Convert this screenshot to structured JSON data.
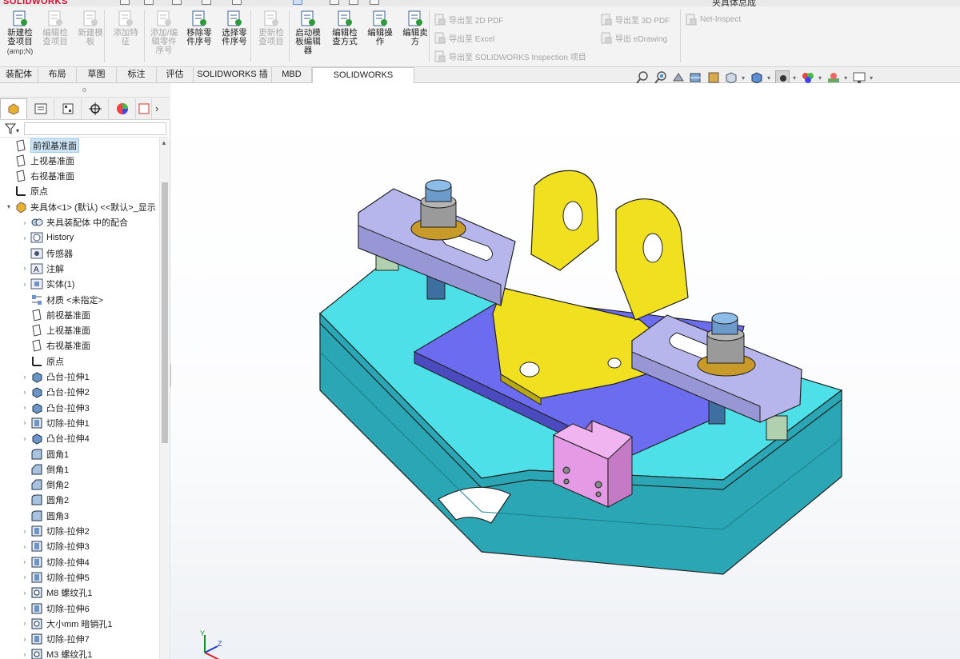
{
  "app": {
    "logo_text": "SOLIDWORKS",
    "document_title": "夹具体总成"
  },
  "ribbon": {
    "buttons": [
      {
        "label": "新建检\n查项目",
        "sub": "(amp;N)",
        "enabled": true,
        "icon": "new-inspection-icon"
      },
      {
        "label": "编辑检\n查项目",
        "sub": "",
        "enabled": false,
        "icon": "edit-inspection-icon"
      },
      {
        "label": "新建模\n板",
        "sub": "",
        "enabled": false,
        "icon": "new-template-icon"
      },
      {
        "label": "添加特\n征",
        "sub": "",
        "enabled": false,
        "icon": "add-feature-icon"
      },
      {
        "label": "添加/编\n辑零件\n序号",
        "sub": "",
        "enabled": false,
        "icon": "balloon-add-icon"
      },
      {
        "label": "移除零\n件序号",
        "sub": "",
        "enabled": true,
        "icon": "balloon-remove-icon"
      },
      {
        "label": "选择零\n件序号",
        "sub": "",
        "enabled": true,
        "icon": "balloon-select-icon"
      },
      {
        "label": "更新检\n查项目",
        "sub": "",
        "enabled": false,
        "icon": "update-inspection-icon"
      },
      {
        "label": "启动模\n板编辑\n器",
        "sub": "",
        "enabled": true,
        "icon": "template-editor-icon"
      },
      {
        "label": "编辑检\n查方式",
        "sub": "",
        "enabled": true,
        "icon": "edit-method-icon"
      },
      {
        "label": "编辑操\n作",
        "sub": "",
        "enabled": true,
        "icon": "edit-operation-icon"
      },
      {
        "label": "编辑卖\n方",
        "sub": "",
        "enabled": true,
        "icon": "edit-vendor-icon"
      }
    ],
    "export_items": [
      {
        "label": "导出至 2D PDF",
        "icon": "pdf2d-icon"
      },
      {
        "label": "导出至 Excel",
        "icon": "excel-icon"
      },
      {
        "label": "导出至 SOLIDWORKS Inspection 项目",
        "icon": "inspection-project-icon"
      },
      {
        "label": "导出至 3D PDF",
        "icon": "pdf3d-icon"
      },
      {
        "label": "导出 eDrawing",
        "icon": "edrawing-icon"
      },
      {
        "label": "Net-Inspect",
        "icon": "net-inspect-icon"
      }
    ]
  },
  "tabs": [
    "装配体",
    "布局",
    "草图",
    "标注",
    "评估",
    "SOLIDWORKS 插件",
    "MBD",
    "SOLIDWORKS Inspection"
  ],
  "active_tab": "SOLIDWORKS Inspection",
  "feature_tree": [
    {
      "label": "前视基准面",
      "icon": "plane-icon",
      "level": 0,
      "expander": "",
      "selected": true
    },
    {
      "label": "上视基准面",
      "icon": "plane-icon",
      "level": 0,
      "expander": ""
    },
    {
      "label": "右视基准面",
      "icon": "plane-icon",
      "level": 0,
      "expander": ""
    },
    {
      "label": "原点",
      "icon": "origin-icon",
      "level": 0,
      "expander": ""
    },
    {
      "label": "夹具体<1> (默认) <<默认>_显示",
      "icon": "part-icon",
      "level": 0,
      "expander": "▾"
    },
    {
      "label": "夹具装配体 中的配合",
      "icon": "mates-icon",
      "level": 1,
      "expander": "›"
    },
    {
      "label": "History",
      "icon": "history-icon",
      "level": 1,
      "expander": "›"
    },
    {
      "label": "传感器",
      "icon": "sensor-icon",
      "level": 1,
      "expander": ""
    },
    {
      "label": "注解",
      "icon": "annotation-icon",
      "level": 1,
      "expander": "›"
    },
    {
      "label": "实体(1)",
      "icon": "solid-bodies-icon",
      "level": 1,
      "expander": "›"
    },
    {
      "label": "材质 <未指定>",
      "icon": "material-icon",
      "level": 1,
      "expander": ""
    },
    {
      "label": "前视基准面",
      "icon": "plane-icon",
      "level": 1,
      "expander": ""
    },
    {
      "label": "上视基准面",
      "icon": "plane-icon",
      "level": 1,
      "expander": ""
    },
    {
      "label": "右视基准面",
      "icon": "plane-icon",
      "level": 1,
      "expander": ""
    },
    {
      "label": "原点",
      "icon": "origin-icon",
      "level": 1,
      "expander": ""
    },
    {
      "label": "凸台-拉伸1",
      "icon": "boss-extrude-icon",
      "level": 1,
      "expander": "›"
    },
    {
      "label": "凸台-拉伸2",
      "icon": "boss-extrude-icon",
      "level": 1,
      "expander": "›"
    },
    {
      "label": "凸台-拉伸3",
      "icon": "boss-extrude-icon",
      "level": 1,
      "expander": "›"
    },
    {
      "label": "切除-拉伸1",
      "icon": "cut-extrude-icon",
      "level": 1,
      "expander": "›"
    },
    {
      "label": "凸台-拉伸4",
      "icon": "boss-extrude-icon",
      "level": 1,
      "expander": "›"
    },
    {
      "label": "圆角1",
      "icon": "fillet-icon",
      "level": 1,
      "expander": ""
    },
    {
      "label": "倒角1",
      "icon": "chamfer-icon",
      "level": 1,
      "expander": ""
    },
    {
      "label": "倒角2",
      "icon": "chamfer-icon",
      "level": 1,
      "expander": ""
    },
    {
      "label": "圆角2",
      "icon": "fillet-icon",
      "level": 1,
      "expander": ""
    },
    {
      "label": "圆角3",
      "icon": "fillet-icon",
      "level": 1,
      "expander": ""
    },
    {
      "label": "切除-拉伸2",
      "icon": "cut-extrude-icon",
      "level": 1,
      "expander": "›"
    },
    {
      "label": "切除-拉伸3",
      "icon": "cut-extrude-icon",
      "level": 1,
      "expander": "›"
    },
    {
      "label": "切除-拉伸4",
      "icon": "cut-extrude-icon",
      "level": 1,
      "expander": "›"
    },
    {
      "label": "切除-拉伸5",
      "icon": "cut-extrude-icon",
      "level": 1,
      "expander": "›"
    },
    {
      "label": "M8 螺纹孔1",
      "icon": "hole-wizard-icon",
      "level": 1,
      "expander": "›"
    },
    {
      "label": "切除-拉伸6",
      "icon": "cut-extrude-icon",
      "level": 1,
      "expander": "›"
    },
    {
      "label": "大小mm 暗销孔1",
      "icon": "hole-wizard-icon",
      "level": 1,
      "expander": "›"
    },
    {
      "label": "切除-拉伸7",
      "icon": "cut-extrude-icon",
      "level": 1,
      "expander": "›"
    },
    {
      "label": "M3 螺纹孔1",
      "icon": "hole-wizard-icon",
      "level": 1,
      "expander": "›"
    }
  ],
  "triad": {
    "x": "X",
    "y": "Y",
    "z": "Z"
  },
  "colors": {
    "base_plate": "#4ee0e8",
    "base_side": "#2aa6b4",
    "top_plate": "#6c6cf0",
    "bracket": "#f0e020",
    "clamp": "#b6b6ec",
    "locator": "#e49ae4",
    "selection": "#cce4f7"
  }
}
